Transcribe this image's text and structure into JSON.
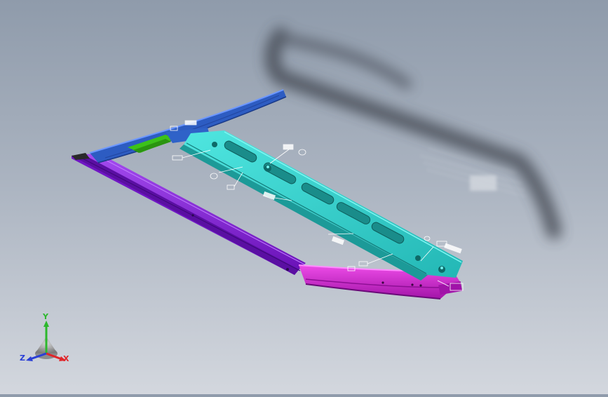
{
  "viewport": {
    "background_top": "#8f9bab",
    "background_bottom": "#d3d7de",
    "parts": [
      {
        "name": "side-rail-blue",
        "color": "#2f62c8"
      },
      {
        "name": "center-rail-cyan",
        "color": "#33d6d0"
      },
      {
        "name": "front-rail-purple",
        "color": "#8c1fe0"
      },
      {
        "name": "end-cap-magenta",
        "color": "#d81ad8"
      },
      {
        "name": "bracket-green",
        "color": "#3ec21a"
      }
    ]
  },
  "triad": {
    "x_label": "X",
    "y_label": "Y",
    "z_label": "Z",
    "x_color": "#e0262a",
    "y_color": "#2db82d",
    "z_color": "#2a3fd6"
  }
}
